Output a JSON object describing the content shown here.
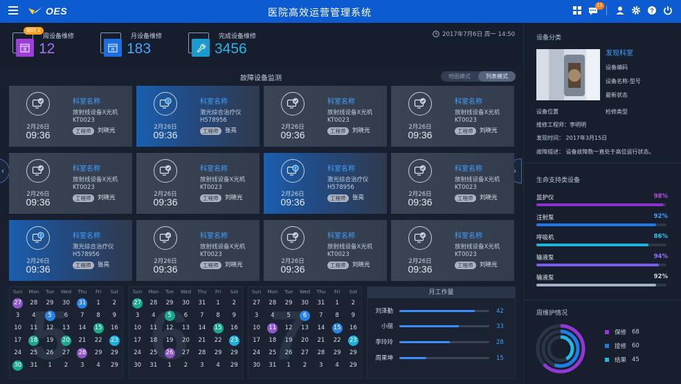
{
  "header": {
    "brand": "OES",
    "title": "医院高效运营管理系统",
    "notification_count": "15"
  },
  "stats": [
    {
      "label": "周设备维修",
      "value": "12",
      "badge": "超时 2"
    },
    {
      "label": "月设备维修",
      "value": "183"
    },
    {
      "label": "完成设备维修",
      "value": "3456"
    }
  ],
  "datetime": "2017年7月6日  周一  14:50",
  "monitor": {
    "title": "故障设备监测",
    "modes": [
      "地图模式",
      "列表模式"
    ]
  },
  "cards": [
    {
      "date": "2月26日",
      "time": "09:36",
      "dept": "科室名称",
      "device": "放射线设备X光机",
      "code": "KT0023",
      "role": "工程师",
      "person": "刘晓光",
      "status": "ok"
    },
    {
      "date": "2月26日",
      "time": "09:36",
      "dept": "科室名称",
      "device": "激光综合治疗仪",
      "code": "H578956",
      "role": "工程师",
      "person": "张亮",
      "status": "alert"
    },
    {
      "date": "2月26日",
      "time": "09:36",
      "dept": "科室名称",
      "device": "放射线设备X光机",
      "code": "KT0023",
      "role": "工程师",
      "person": "刘晓光",
      "status": "ok"
    },
    {
      "date": "2月26日",
      "time": "09:36",
      "dept": "科室名称",
      "device": "放射线设备X光机",
      "code": "KT0023",
      "role": "工程师",
      "person": "刘晓光",
      "status": "ok"
    },
    {
      "date": "2月26日",
      "time": "09:36",
      "dept": "科室名称",
      "device": "放射线设备X光机",
      "code": "KT0023",
      "role": "工程师",
      "person": "刘晓光",
      "status": "ok"
    },
    {
      "date": "2月26日",
      "time": "09:36",
      "dept": "科室名称",
      "device": "放射线设备X光机",
      "code": "KT0023",
      "role": "工程师",
      "person": "刘晓光",
      "status": "ok"
    },
    {
      "date": "2月26日",
      "time": "09:36",
      "dept": "科室名称",
      "device": "激光综合治疗仪",
      "code": "H578956",
      "role": "工程师",
      "person": "张亮",
      "status": "alert"
    },
    {
      "date": "2月26日",
      "time": "09:36",
      "dept": "科室名称",
      "device": "放射线设备X光机",
      "code": "KT0023",
      "role": "工程师",
      "person": "刘晓光",
      "status": "ok"
    },
    {
      "date": "2月26日",
      "time": "09:36",
      "dept": "科室名称",
      "device": "激光综合治疗仪",
      "code": "H578956",
      "role": "工程师",
      "person": "张亮",
      "status": "alert"
    },
    {
      "date": "2月26日",
      "time": "09:36",
      "dept": "科室名称",
      "device": "放射线设备X光机",
      "code": "KT0023",
      "role": "工程师",
      "person": "刘晓光",
      "status": "ok"
    },
    {
      "date": "2月26日",
      "time": "09:36",
      "dept": "科室名称",
      "device": "放射线设备X光机",
      "code": "KT0023",
      "role": "工程师",
      "person": "刘晓光",
      "status": "ok"
    },
    {
      "date": "2月26日",
      "time": "09:36",
      "dept": "科室名称",
      "device": "放射线设备X光机",
      "code": "KT0023",
      "role": "工程师",
      "person": "刘晓光",
      "status": "ok"
    }
  ],
  "calendars": [
    {
      "month": "5",
      "weekdays": [
        "Sun",
        "Mon",
        "Tue",
        "Wed",
        "Thu",
        "Fri",
        "Sat"
      ],
      "days": [
        [
          "27",
          "28",
          "29",
          "30",
          "31",
          "1",
          "2"
        ],
        [
          "3",
          "4",
          "5",
          "6",
          "7",
          "8",
          "9"
        ],
        [
          "10",
          "11",
          "12",
          "13",
          "14",
          "15",
          "16"
        ],
        [
          "17",
          "18",
          "19",
          "20",
          "21",
          "22",
          "23"
        ],
        [
          "24",
          "25",
          "26",
          "27",
          "28",
          "29",
          "29"
        ],
        [
          "30",
          "31",
          "1",
          "2",
          "3",
          "4",
          "29"
        ]
      ],
      "marks": {
        "0-0": "purple",
        "0-4": "blue",
        "1-2": "blue",
        "2-5": "teal",
        "3-1": "teal",
        "3-3": "teal",
        "3-6": "cyan",
        "4-4": "purple",
        "5-0": "teal"
      }
    },
    {
      "month": "6",
      "weekdays": [
        "Sun",
        "Mon",
        "Tue",
        "Wed",
        "Thu",
        "Fri",
        "Sat"
      ],
      "days": [
        [
          "27",
          "28",
          "29",
          "30",
          "31",
          "1",
          "2"
        ],
        [
          "3",
          "4",
          "5",
          "6",
          "7",
          "8",
          "9"
        ],
        [
          "10",
          "11",
          "12",
          "13",
          "14",
          "15",
          "16"
        ],
        [
          "17",
          "18",
          "19",
          "20",
          "21",
          "22",
          "23"
        ],
        [
          "24",
          "25",
          "26",
          "27",
          "28",
          "29",
          "29"
        ],
        [
          "30",
          "31",
          "1",
          "2",
          "3",
          "4",
          "29"
        ]
      ],
      "marks": {
        "0-0": "teal",
        "1-2": "teal",
        "2-5": "teal",
        "3-6": "cyan",
        "4-2": "purple"
      }
    },
    {
      "month": "7",
      "weekdays": [
        "Sun",
        "Mon",
        "Tue",
        "Wed",
        "Thu",
        "Fri",
        "Sat"
      ],
      "days": [
        [
          "27",
          "28",
          "29",
          "30",
          "31",
          "1",
          "2"
        ],
        [
          "3",
          "4",
          "5",
          "6",
          "7",
          "8",
          "9"
        ],
        [
          "10",
          "11",
          "12",
          "13",
          "14",
          "15",
          "16"
        ],
        [
          "17",
          "18",
          "19",
          "20",
          "21",
          "22",
          "23"
        ],
        [
          "24",
          "25",
          "26",
          "27",
          "28",
          "29",
          "29"
        ],
        [
          "30",
          "31",
          "1",
          "2",
          "3",
          "4",
          "29"
        ]
      ],
      "marks": {
        "1-3": "blue",
        "2-1": "purple",
        "2-5": "blue",
        "3-6": "cyan"
      }
    }
  ],
  "workload": {
    "title": "月工作量",
    "max": 50,
    "items": [
      {
        "name": "刘泽勤",
        "value": 42
      },
      {
        "name": "小丽",
        "value": 33
      },
      {
        "name": "李玲玲",
        "value": 28
      },
      {
        "name": "周果坤",
        "value": 15
      }
    ]
  },
  "device": {
    "section_title": "设备分类",
    "dept": "发现科室",
    "lines": [
      "设备编码",
      "设备名称-型号",
      "最新状态"
    ],
    "location_label": "设备位置",
    "check_label": "检修类型",
    "engineer": "维修工程师：李明明",
    "time": "发现时间：  2017年3月15日",
    "desc": "故障描述：  设备故障数一直处于高位运行状态。"
  },
  "support": {
    "title": "生命支持类设备",
    "items": [
      {
        "name": "监护仪",
        "value": "98%",
        "pct": 98,
        "color": "#b04fe0",
        "fill": "#8e2fcf"
      },
      {
        "name": "注射泵",
        "value": "92%",
        "pct": 92,
        "color": "#3ea2ff",
        "fill": "#1e78e8"
      },
      {
        "name": "呼吸机",
        "value": "86%",
        "pct": 86,
        "color": "#2bc3e6",
        "fill": "#1fb4d9"
      },
      {
        "name": "输液泵",
        "value": "94%",
        "pct": 94,
        "color": "#9a70ff",
        "fill": "#7a5cf0"
      },
      {
        "name": "输液泵",
        "value": "92%",
        "pct": 92,
        "color": "#d0d8e4",
        "fill": "#9fb0c8"
      }
    ]
  },
  "maintenance": {
    "title": "周维护情况",
    "items": [
      {
        "name": "保修",
        "value": "68",
        "color": "#9238d6"
      },
      {
        "name": "接修",
        "value": "60",
        "color": "#1f7de6"
      },
      {
        "name": "结果",
        "value": "45",
        "color": "#24b8dc"
      }
    ]
  }
}
